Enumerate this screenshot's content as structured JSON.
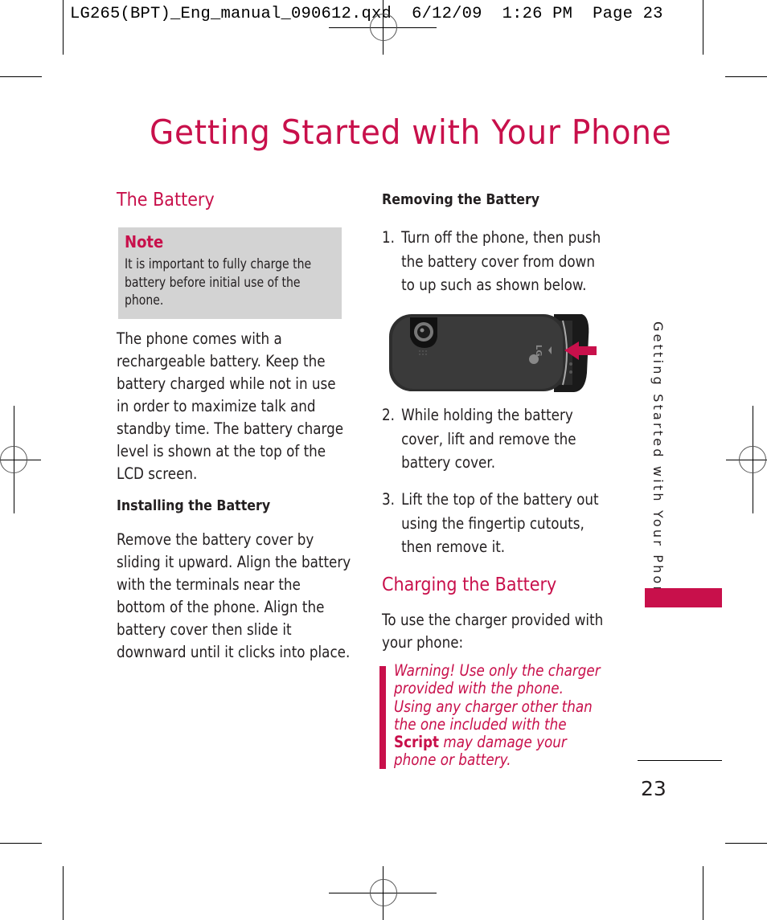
{
  "slug": "LG265(BPT)_Eng_manual_090612.qxd  6/12/09  1:26 PM  Page 23",
  "page_title": "Getting Started with Your Phone",
  "left_column": {
    "battery_heading": "The Battery",
    "note": {
      "title": "Note",
      "text": "It is important to fully charge the battery before initial use of the phone."
    },
    "intro": "The phone comes with a rechargeable battery. Keep the battery charged while not in use in order to maximize talk and standby time. The battery charge level is shown at the top of the LCD screen.",
    "installing_heading": "Installing the Battery",
    "installing_text": "Remove the battery cover by sliding it upward. Align the battery with the terminals near the bottom of the phone. Align the battery cover then slide it downward until it clicks into place."
  },
  "right_column": {
    "removing_heading": "Removing the Battery",
    "steps": [
      {
        "num": "1.",
        "text": "Turn off the phone, then push the battery cover from down to up such as shown below."
      },
      {
        "num": "2.",
        "text": "While holding the battery cover, lift and remove the battery cover."
      },
      {
        "num": "3.",
        "text": "Lift the top of the battery out using the fingertip cutouts, then remove it."
      }
    ],
    "image": {
      "brand": "LG",
      "description": "Back of phone with battery cover and arrow"
    },
    "charging_heading": "Charging the Battery",
    "charging_intro": "To use the charger provided with your phone:",
    "warning": {
      "before": "Warning! Use only the charger provided with the phone. Using any charger other than the one included with the ",
      "product": "Script",
      "after": " may damage your phone or battery."
    }
  },
  "side_tab_label": "Getting Started with Your Phone",
  "page_number": "23",
  "colors": {
    "accent": "#c8104b",
    "note_bg": "#d3d3d3",
    "text": "#231f20"
  }
}
